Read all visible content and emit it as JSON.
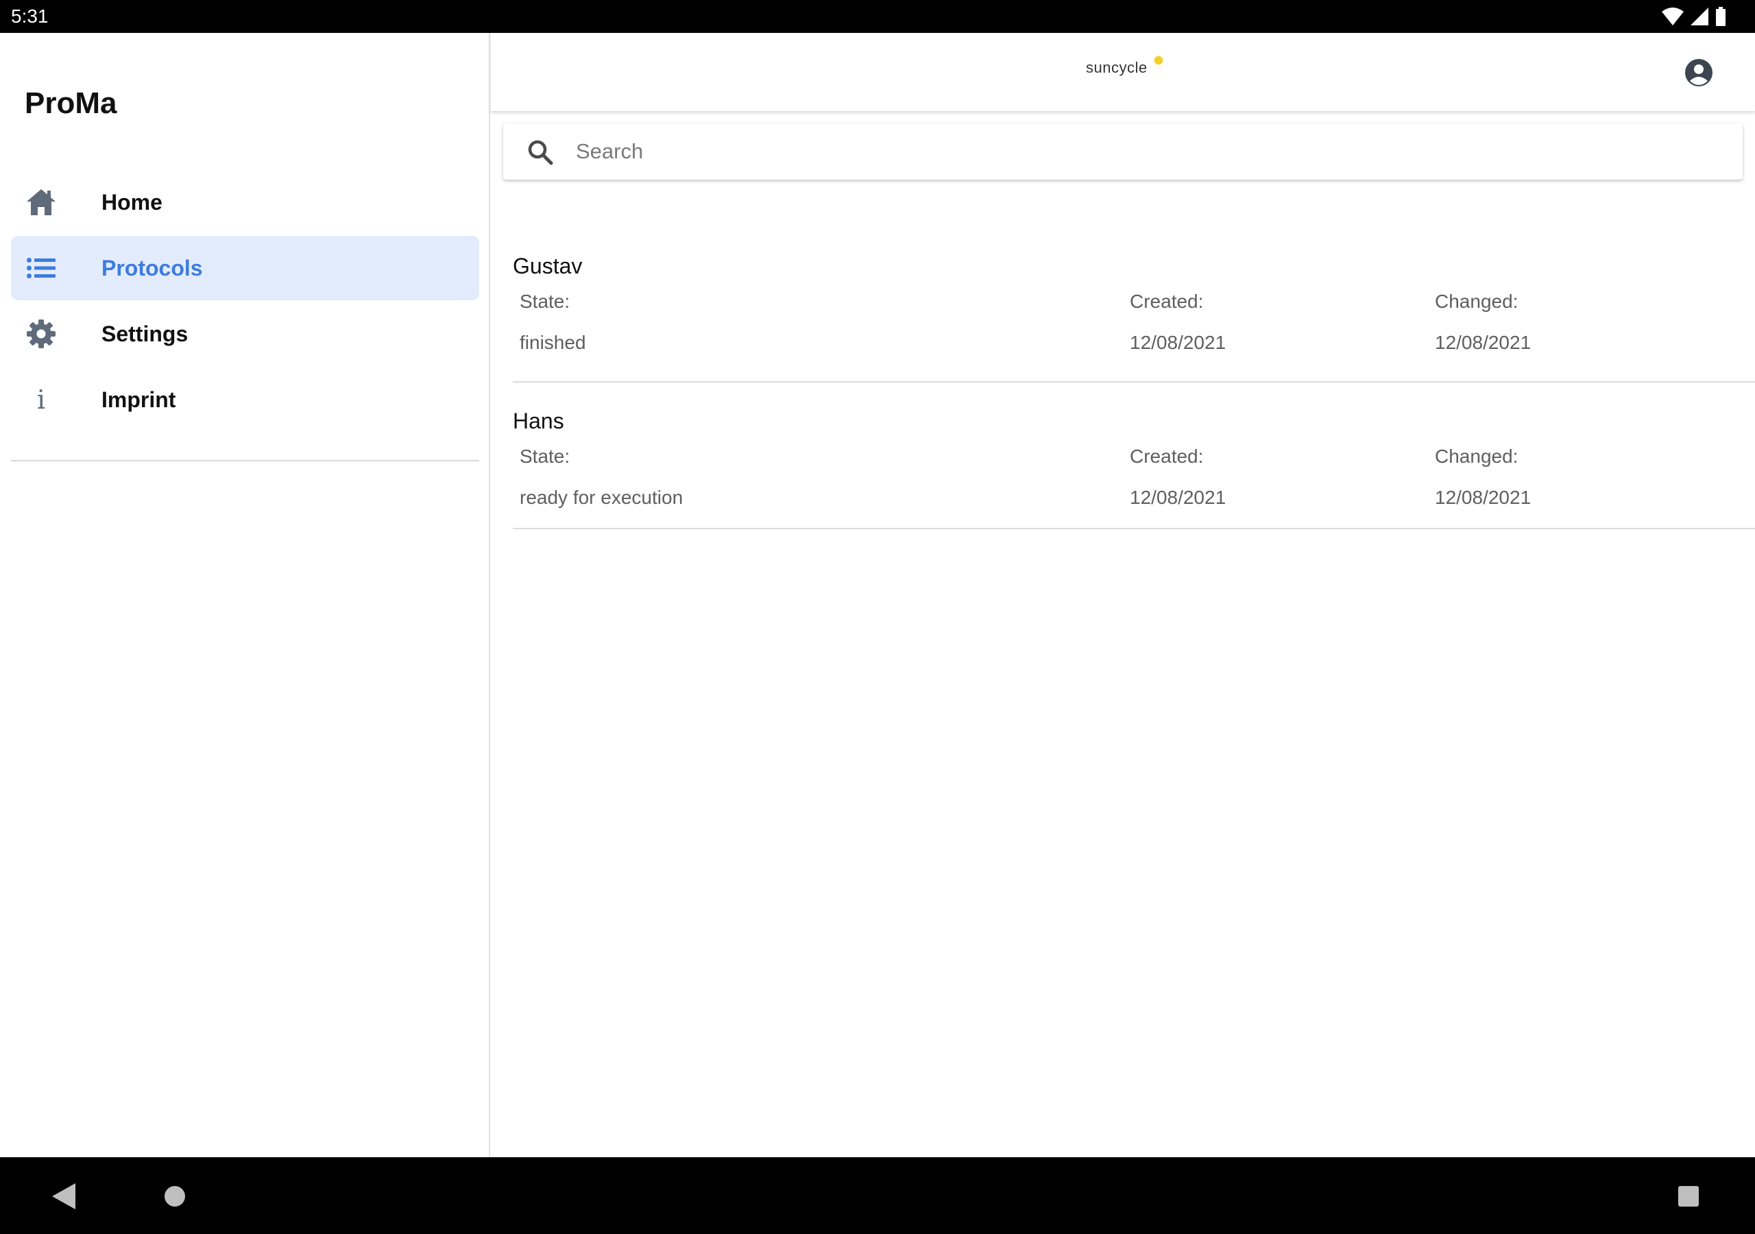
{
  "status_bar": {
    "time": "5:31",
    "icons": [
      "wifi-icon",
      "signal-icon",
      "battery-icon"
    ]
  },
  "drawer": {
    "title": "ProMa",
    "items": [
      {
        "label": "Home",
        "icon": "home-icon",
        "active": false
      },
      {
        "label": "Protocols",
        "icon": "list-icon",
        "active": true
      },
      {
        "label": "Settings",
        "icon": "gear-icon",
        "active": false
      },
      {
        "label": "Imprint",
        "icon": "info-icon",
        "active": false
      }
    ]
  },
  "app_bar": {
    "logo_text": "suncycle",
    "account_icon": "account-circle-icon"
  },
  "search": {
    "placeholder": "Search",
    "value": ""
  },
  "protocols": {
    "labels": {
      "state": "State:",
      "created": "Created:",
      "changed": "Changed:"
    },
    "items": [
      {
        "name": "Gustav",
        "state": "finished",
        "created": "12/08/2021",
        "changed": "12/08/2021"
      },
      {
        "name": "Hans",
        "state": "ready for execution",
        "created": "12/08/2021",
        "changed": "12/08/2021"
      }
    ]
  },
  "colors": {
    "accent": "#3d7be0",
    "active_bg": "#e3ecfc",
    "icon_gray": "#5f6b7a",
    "logo_sun": "#f2d024"
  },
  "system_nav": {
    "buttons": [
      "back-icon",
      "home-circle-icon",
      "recents-icon"
    ]
  }
}
